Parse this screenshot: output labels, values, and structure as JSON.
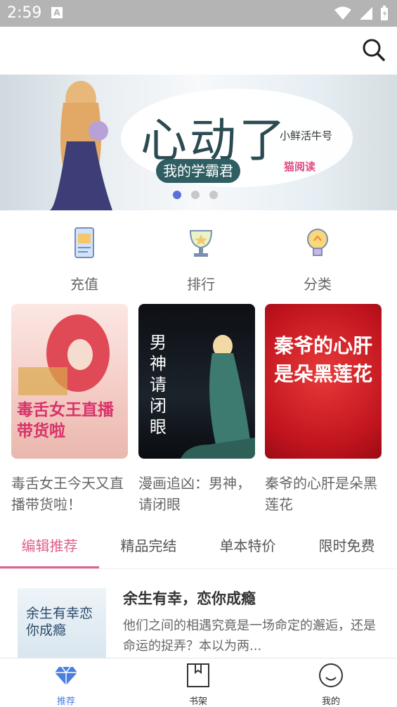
{
  "status": {
    "time": "2:59",
    "a_badge": "A"
  },
  "banner": {
    "title": "心动了",
    "subtitle": "我的学霸君",
    "author": "小鲜活牛号",
    "brand": "猫阅读"
  },
  "quick": [
    {
      "label": "充值",
      "icon": "phone-card-icon"
    },
    {
      "label": "排行",
      "icon": "trophy-icon"
    },
    {
      "label": "分类",
      "icon": "lightbulb-icon"
    }
  ],
  "books": [
    {
      "title": "毒舌女王今天又直播带货啦！",
      "cover_text": "毒舌女王直播带货啦"
    },
    {
      "title": "漫画追凶：男神，请闭眼",
      "cover_text": "男神请闭眼"
    },
    {
      "title": "秦爷的心肝是朵黑莲花",
      "cover_text": "秦爷的心肝是朵黑莲花"
    }
  ],
  "tabs": [
    "编辑推荐",
    "精品完结",
    "单本特价",
    "限时免费"
  ],
  "recommend": {
    "title": "余生有幸，恋你成瘾",
    "cover_text": "余生有幸恋你成瘾",
    "desc": "他们之间的相遇究竟是一场命定的邂逅，还是命运的捉弄？本以为两..."
  },
  "nav": [
    "推荐",
    "书架",
    "我的"
  ],
  "colors": {
    "accent": "#e0608a",
    "nav_active": "#4a7fe0",
    "dot_active": "#5b6fd6"
  }
}
